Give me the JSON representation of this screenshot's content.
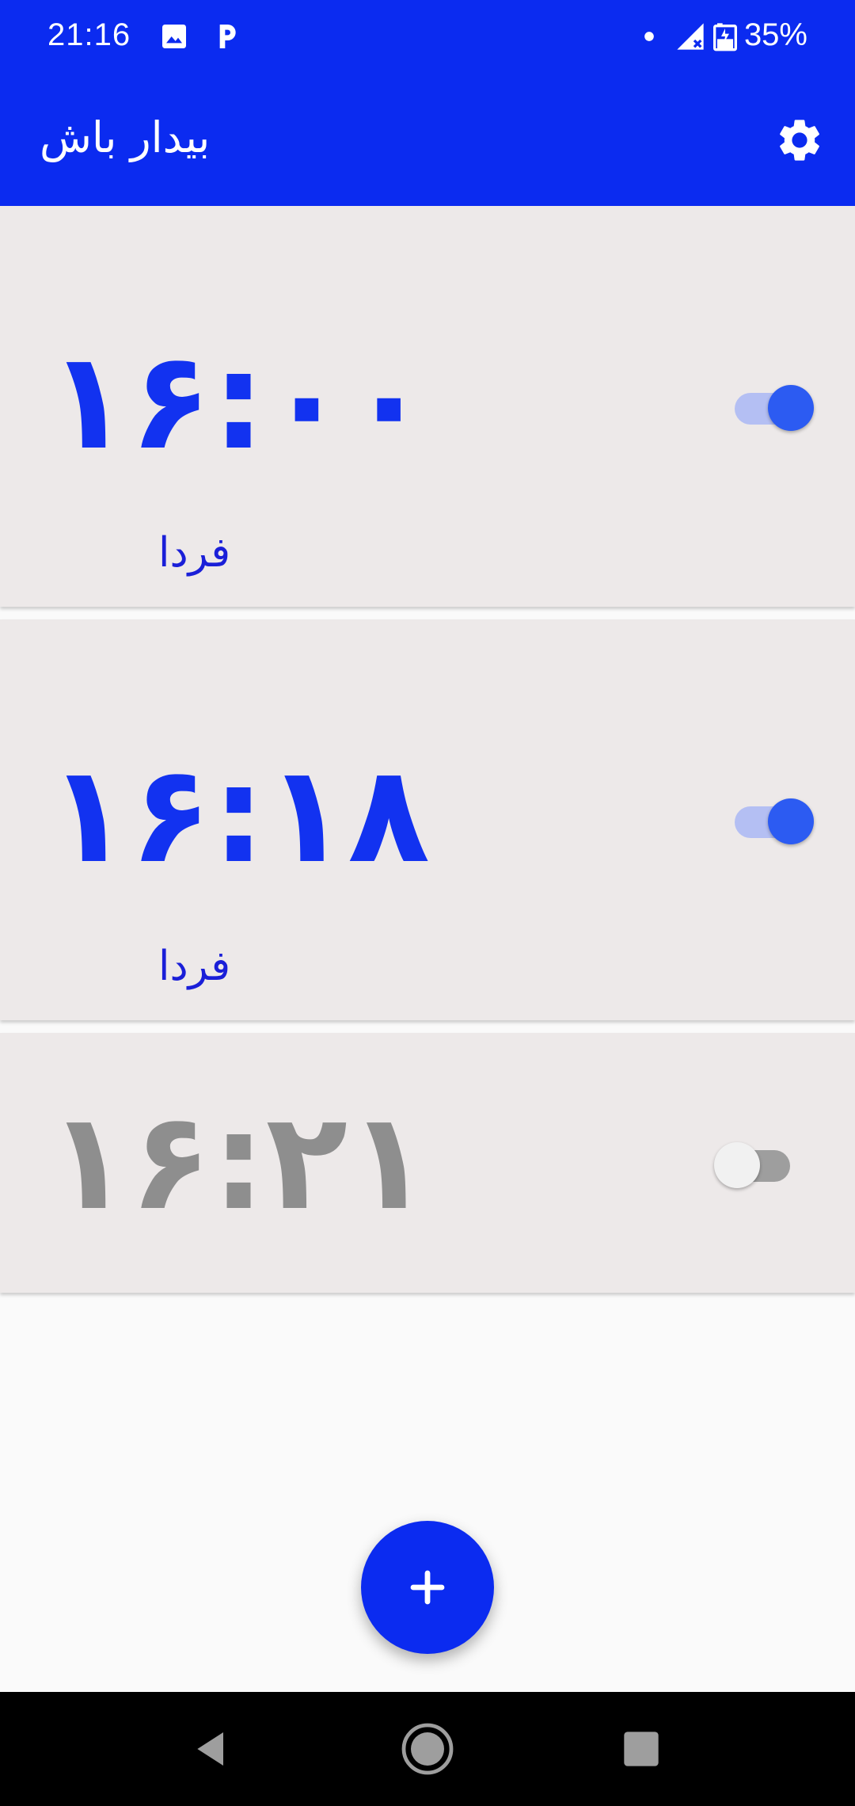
{
  "status_bar": {
    "time": "21:16",
    "battery": "35%",
    "icons": [
      "image-icon",
      "parking-icon",
      "dot-icon",
      "signal-icon",
      "battery-icon"
    ]
  },
  "app_bar": {
    "title": "بیدار باش",
    "settings_icon": "gear-icon"
  },
  "alarms": [
    {
      "time": "۱۶:۰۰",
      "day": "فردا",
      "enabled": true
    },
    {
      "time": "۱۶:۱۸",
      "day": "فردا",
      "enabled": true
    },
    {
      "time": "۱۶:۲۱",
      "day": "",
      "enabled": false
    }
  ],
  "fab": {
    "icon": "plus-icon"
  },
  "nav_bar": {
    "icons": [
      "back-icon",
      "home-icon",
      "recents-icon"
    ]
  },
  "colors": {
    "primary": "#0b2bf0",
    "alarm_on": "#1232f0",
    "alarm_off": "#8e8e8e",
    "card_bg": "#ede9e9"
  }
}
